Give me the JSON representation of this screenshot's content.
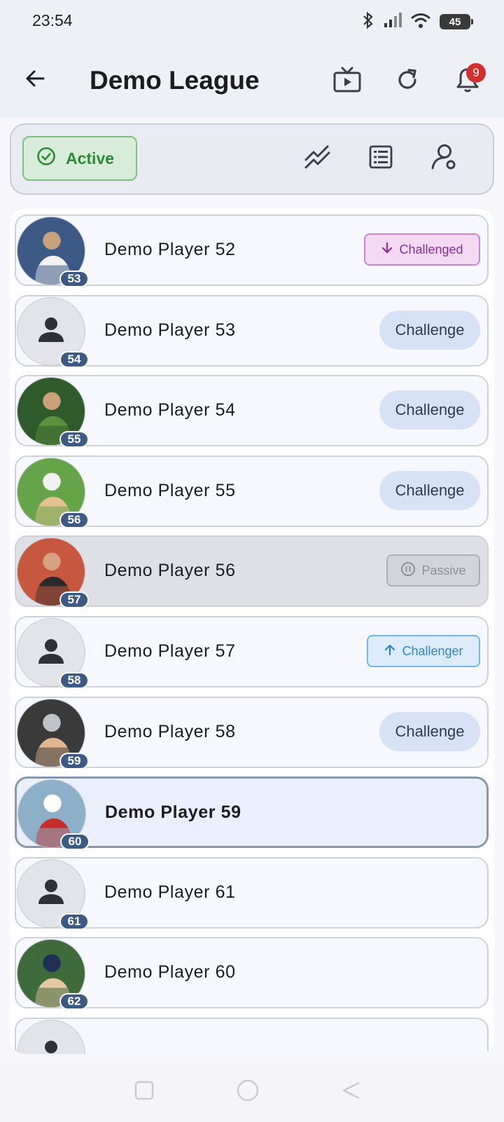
{
  "status_bar": {
    "time": "23:54",
    "battery": "45"
  },
  "app_bar": {
    "title": "Demo League",
    "notification_count": "9"
  },
  "filter": {
    "active_label": "Active"
  },
  "players": [
    {
      "name": "Demo Player 52",
      "rank": "53",
      "photo": true,
      "action": "tag-challenged",
      "action_label": "Challenged"
    },
    {
      "name": "Demo Player 53",
      "rank": "54",
      "photo": false,
      "action": "challenge",
      "action_label": "Challenge"
    },
    {
      "name": "Demo Player 54",
      "rank": "55",
      "photo": true,
      "action": "challenge",
      "action_label": "Challenge"
    },
    {
      "name": "Demo Player 55",
      "rank": "56",
      "photo": true,
      "action": "challenge",
      "action_label": "Challenge"
    },
    {
      "name": "Demo Player 56",
      "rank": "57",
      "photo": true,
      "action": "tag-passive",
      "action_label": "Passive",
      "passive": true
    },
    {
      "name": "Demo Player 57",
      "rank": "58",
      "photo": false,
      "action": "tag-challenger",
      "action_label": "Challenger"
    },
    {
      "name": "Demo Player 58",
      "rank": "59",
      "photo": true,
      "action": "challenge",
      "action_label": "Challenge"
    },
    {
      "name": "Demo Player 59",
      "rank": "60",
      "photo": true,
      "action": "none",
      "action_label": "",
      "current": true
    },
    {
      "name": "Demo Player 61",
      "rank": "61",
      "photo": false,
      "action": "none",
      "action_label": ""
    },
    {
      "name": "Demo Player 60",
      "rank": "62",
      "photo": true,
      "action": "none",
      "action_label": ""
    },
    {
      "name": "",
      "rank": "",
      "photo": false,
      "action": "none",
      "action_label": ""
    }
  ],
  "icons": {
    "back": "arrow-left-icon",
    "tv": "tv-play-icon",
    "refresh": "refresh-icon",
    "bell": "bell-icon",
    "check": "check-circle-icon",
    "chart": "trend-chart-icon",
    "list": "list-icon",
    "search": "person-search-icon"
  },
  "colors": {
    "active_green": "#2c8a34",
    "challenged_purple": "#8a2d9b",
    "challenger_blue": "#2b86c6",
    "rank_badge": "#3c5a86",
    "notification_red": "#d32f2f"
  }
}
